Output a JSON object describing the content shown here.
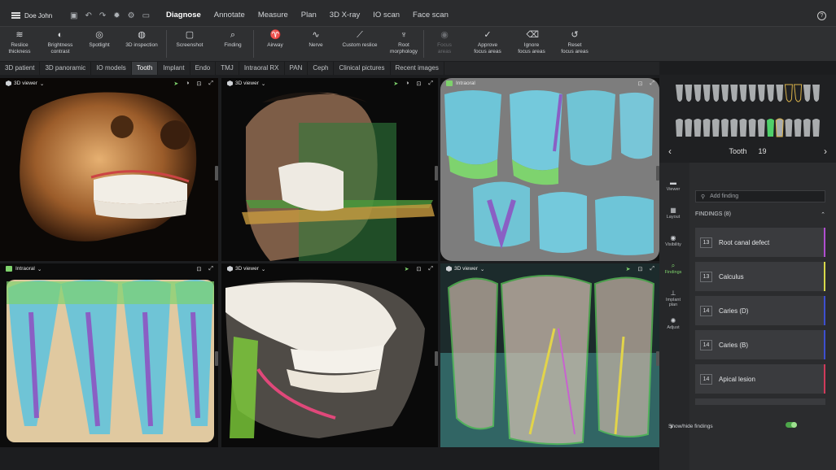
{
  "user": {
    "name": "Doe John"
  },
  "menu": {
    "tabs": [
      "Diagnose",
      "Annotate",
      "Measure",
      "Plan",
      "3D X-ray",
      "IO scan",
      "Face scan"
    ]
  },
  "toolbar": {
    "tools": [
      {
        "label": "Reslice\nthickness",
        "icon": "reslice-icon"
      },
      {
        "label": "Brightness\ncontrast",
        "icon": "contrast-icon"
      },
      {
        "label": "Spotlight",
        "icon": "spotlight-icon"
      },
      {
        "label": "3D inspection",
        "icon": "inspection-icon"
      },
      {
        "label": "Screenshot",
        "icon": "screenshot-icon"
      },
      {
        "label": "Finding",
        "icon": "finding-icon"
      },
      {
        "label": "Airway",
        "icon": "airway-icon"
      },
      {
        "label": "Nerve",
        "icon": "nerve-icon"
      },
      {
        "label": "Custom reslice",
        "icon": "custom-reslice-icon"
      },
      {
        "label": "Root\nmorphology",
        "icon": "root-icon"
      },
      {
        "label": "Focus\nareas",
        "icon": "focus-icon"
      },
      {
        "label": "Approve\nfocus areas",
        "icon": "approve-icon"
      },
      {
        "label": "Ignore\nfocus areas",
        "icon": "ignore-icon"
      },
      {
        "label": "Reset\nfocus areas",
        "icon": "reset-icon"
      }
    ]
  },
  "subtabs": [
    "3D patient",
    "3D panoramic",
    "IO models",
    "Tooth",
    "Implant",
    "Endo",
    "TMJ",
    "Intraoral RX",
    "PAN",
    "Ceph",
    "Clinical pictures",
    "Recent images"
  ],
  "viewports": [
    {
      "title": "3D viewer"
    },
    {
      "title": "3D viewer"
    },
    {
      "title": "Intraoral"
    },
    {
      "title": "Intraoral"
    },
    {
      "title": "3D viewer"
    },
    {
      "title": "3D viewer"
    }
  ],
  "tooth": {
    "label": "Tooth",
    "number": "19"
  },
  "sidenav": [
    "Viewer",
    "Layout",
    "Visibility",
    "Findings",
    "Implant\nplan",
    "Adjust"
  ],
  "findings": {
    "add_placeholder": "Add finding",
    "header": "FINDINGS (8)",
    "items": [
      {
        "num": "13",
        "label": "Root canal defect",
        "color": "#b04ed0"
      },
      {
        "num": "13",
        "label": "Calculus",
        "color": "#d8d84a"
      },
      {
        "num": "14",
        "label": "Caries (D)",
        "color": "#3d4fd0"
      },
      {
        "num": "14",
        "label": "Caries (B)",
        "color": "#3d4fd0"
      },
      {
        "num": "14",
        "label": "Apical lesion",
        "color": "#d03a5a"
      }
    ],
    "show_hide": "Show/hide findings"
  }
}
